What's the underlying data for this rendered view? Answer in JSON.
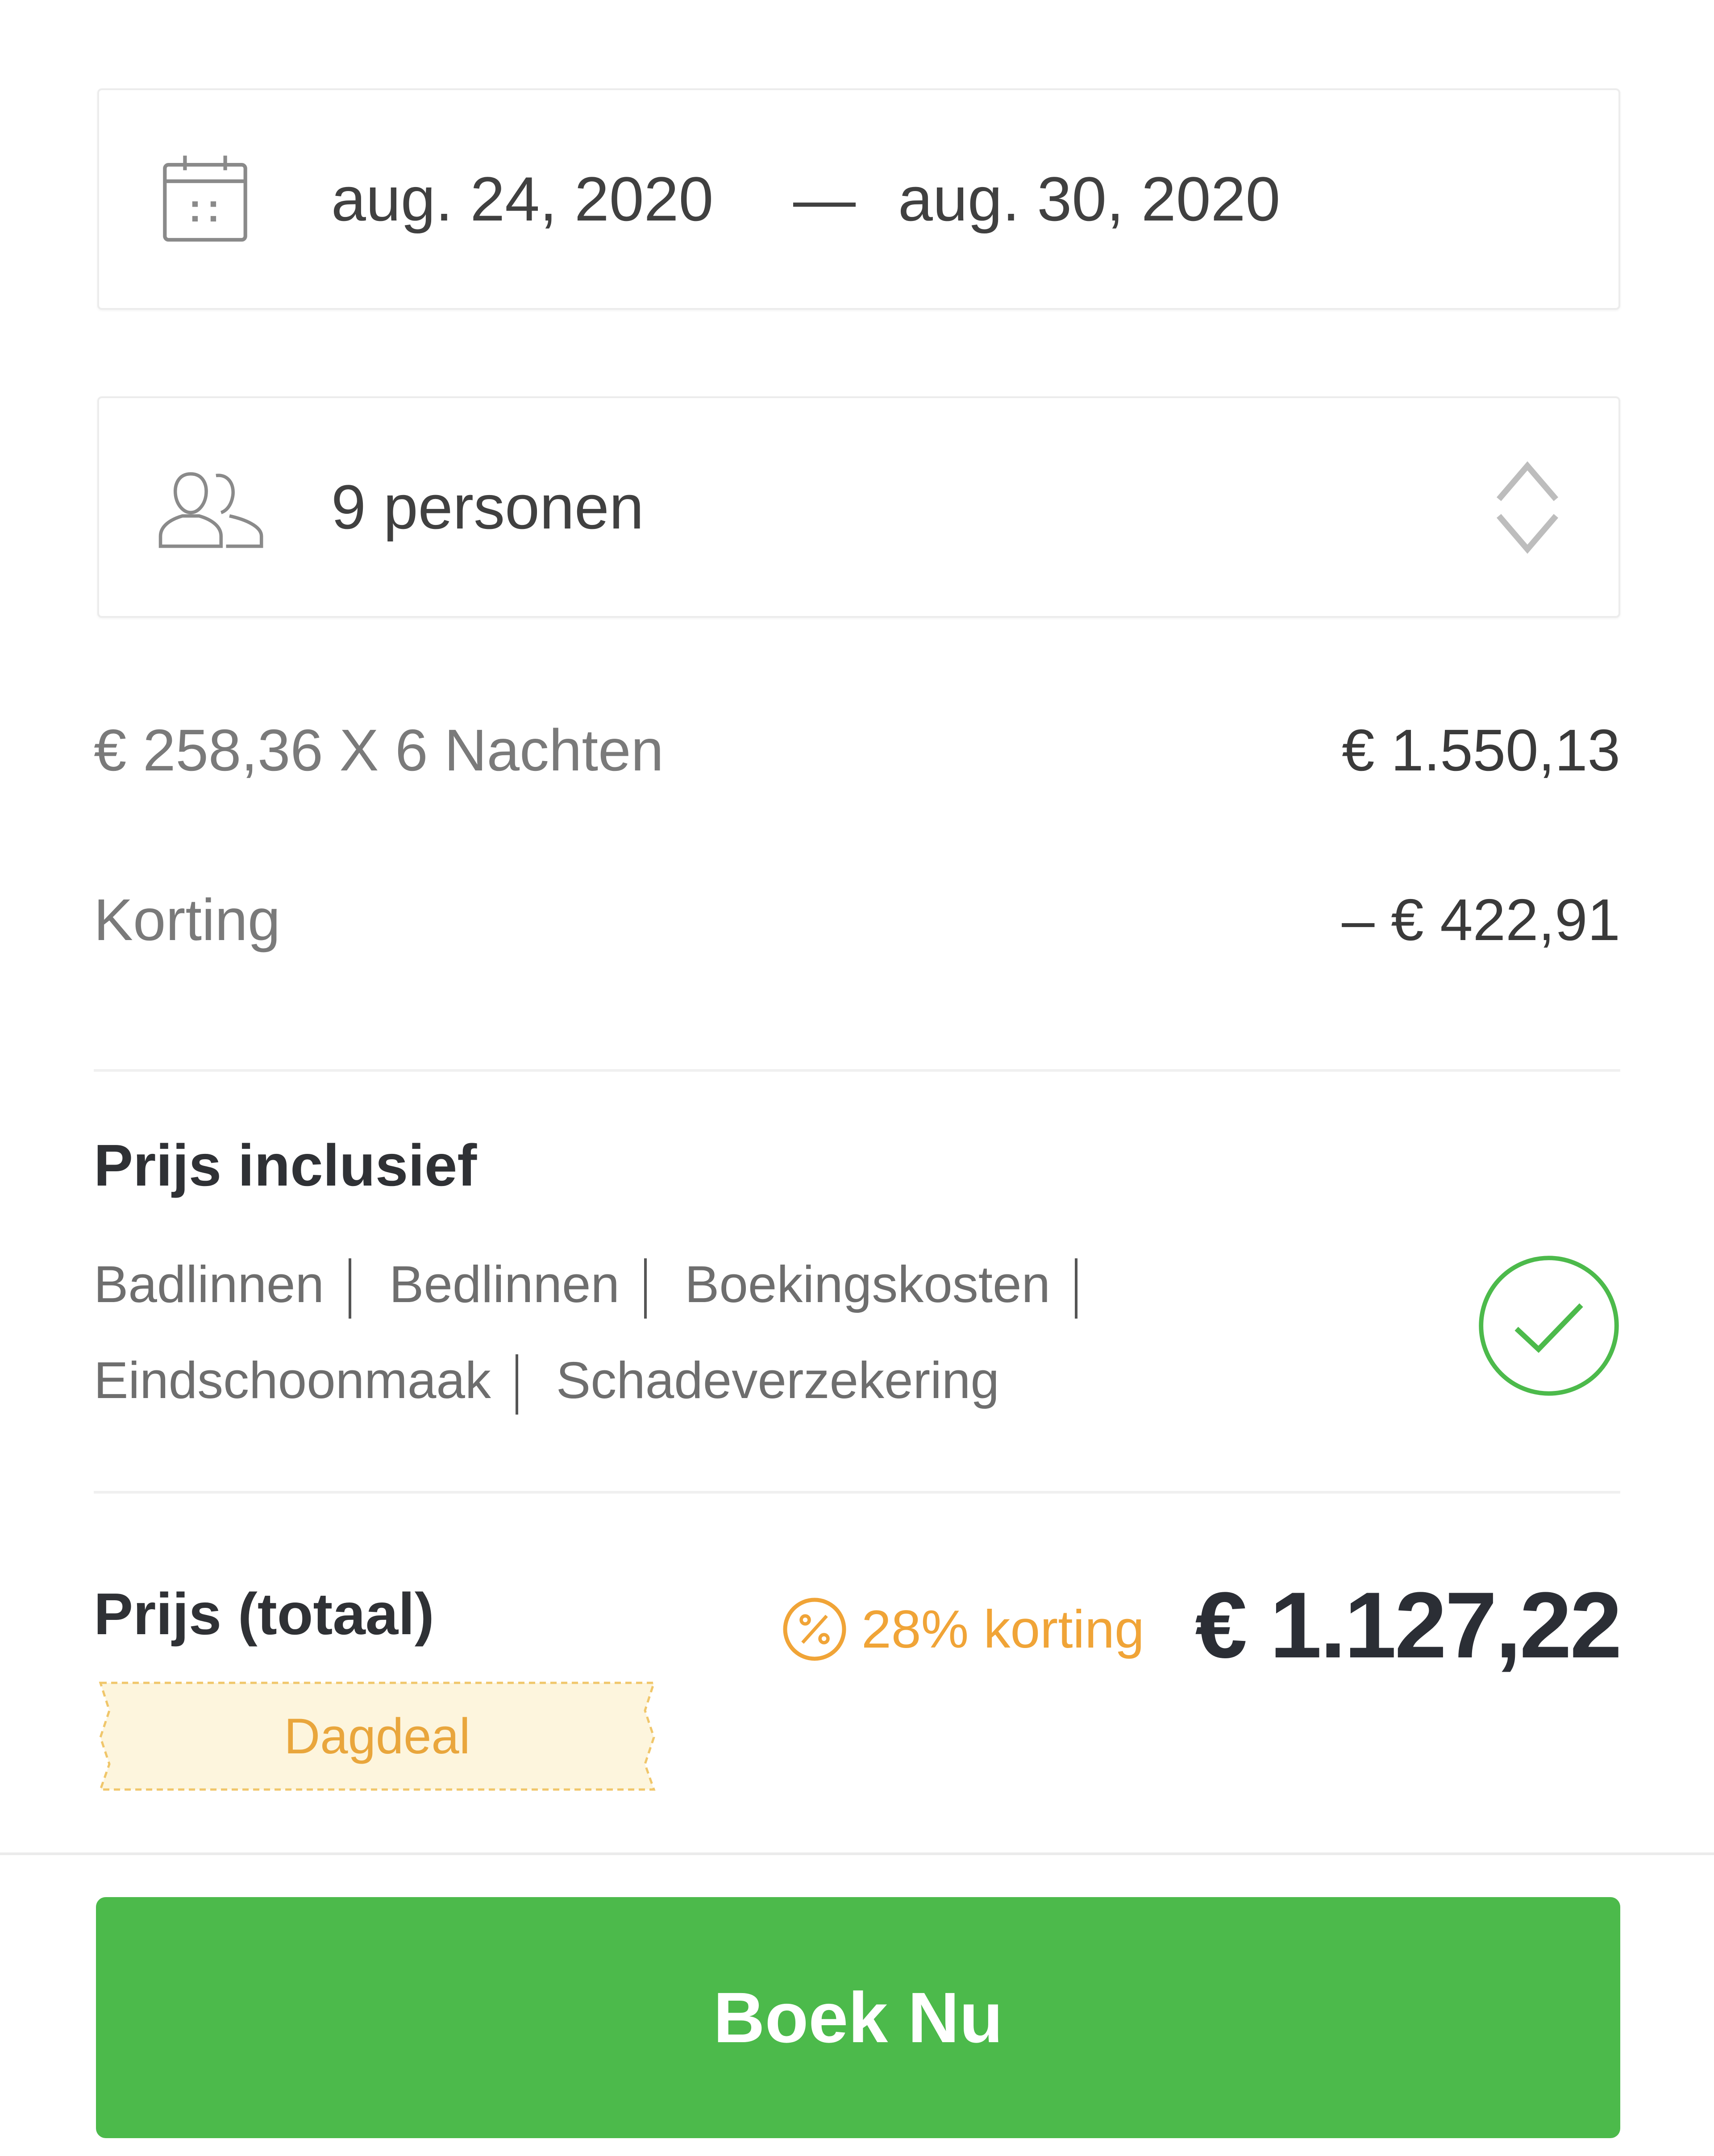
{
  "booking": {
    "dates": {
      "icon": "calendar-icon",
      "start": "aug. 24, 2020",
      "separator": "—",
      "end": "aug. 30, 2020"
    },
    "guests": {
      "icon": "people-icon",
      "value": "9 personen",
      "toggle_icon": "up-down-chevron-icon"
    }
  },
  "price_lines": [
    {
      "label": "€ 258,36 X 6 Nachten",
      "value": "€ 1.550,13"
    },
    {
      "label": "Korting",
      "value": "– € 422,91"
    }
  ],
  "included": {
    "title": "Prijs inclusief",
    "items": [
      "Badlinnen",
      "Bedlinnen",
      "Boekingskosten",
      "Eindschoonmaak",
      "Schadeverzekering"
    ],
    "icon": "check-circle-icon"
  },
  "total": {
    "label": "Prijs (totaal)",
    "deal_badge": "Dagdeal",
    "discount_icon": "percent-icon",
    "discount_text": "28% korting",
    "price": "€ 1.127,22"
  },
  "cta": {
    "label": "Boek Nu"
  },
  "colors": {
    "accent_green": "#4cba4b",
    "discount_orange": "#f0a437",
    "deal_background": "#fdf5dd",
    "check_green": "#4cba4b"
  }
}
